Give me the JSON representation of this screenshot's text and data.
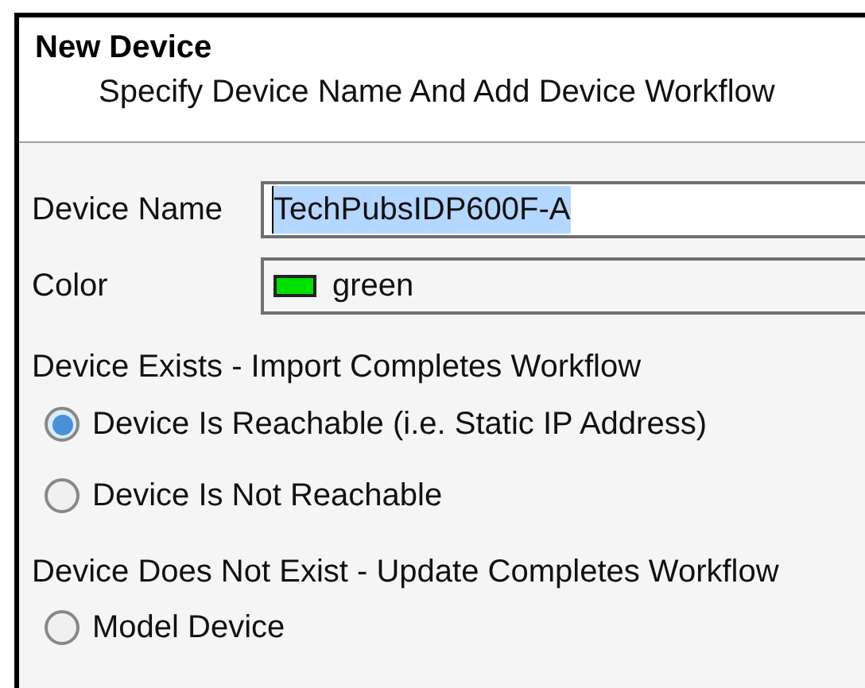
{
  "header": {
    "title": "New Device",
    "subtitle": "Specify Device Name And Add Device Workflow"
  },
  "fields": [
    {
      "kind": "text",
      "label": "Device Name",
      "value": "TechPubsIDP600F-A",
      "selected_text": true
    },
    {
      "kind": "color",
      "label": "Color",
      "value": "green",
      "color": "#00e000"
    }
  ],
  "groups": [
    {
      "label": "Device Exists - Import Completes Workflow",
      "options": [
        {
          "label": "Device Is Reachable (i.e. Static IP Address)",
          "selected": true
        },
        {
          "label": "Device Is Not Reachable",
          "selected": false
        }
      ]
    },
    {
      "label": "Device Does Not Exist - Update Completes Workflow",
      "options": [
        {
          "label": "Model Device",
          "selected": false
        }
      ]
    }
  ]
}
